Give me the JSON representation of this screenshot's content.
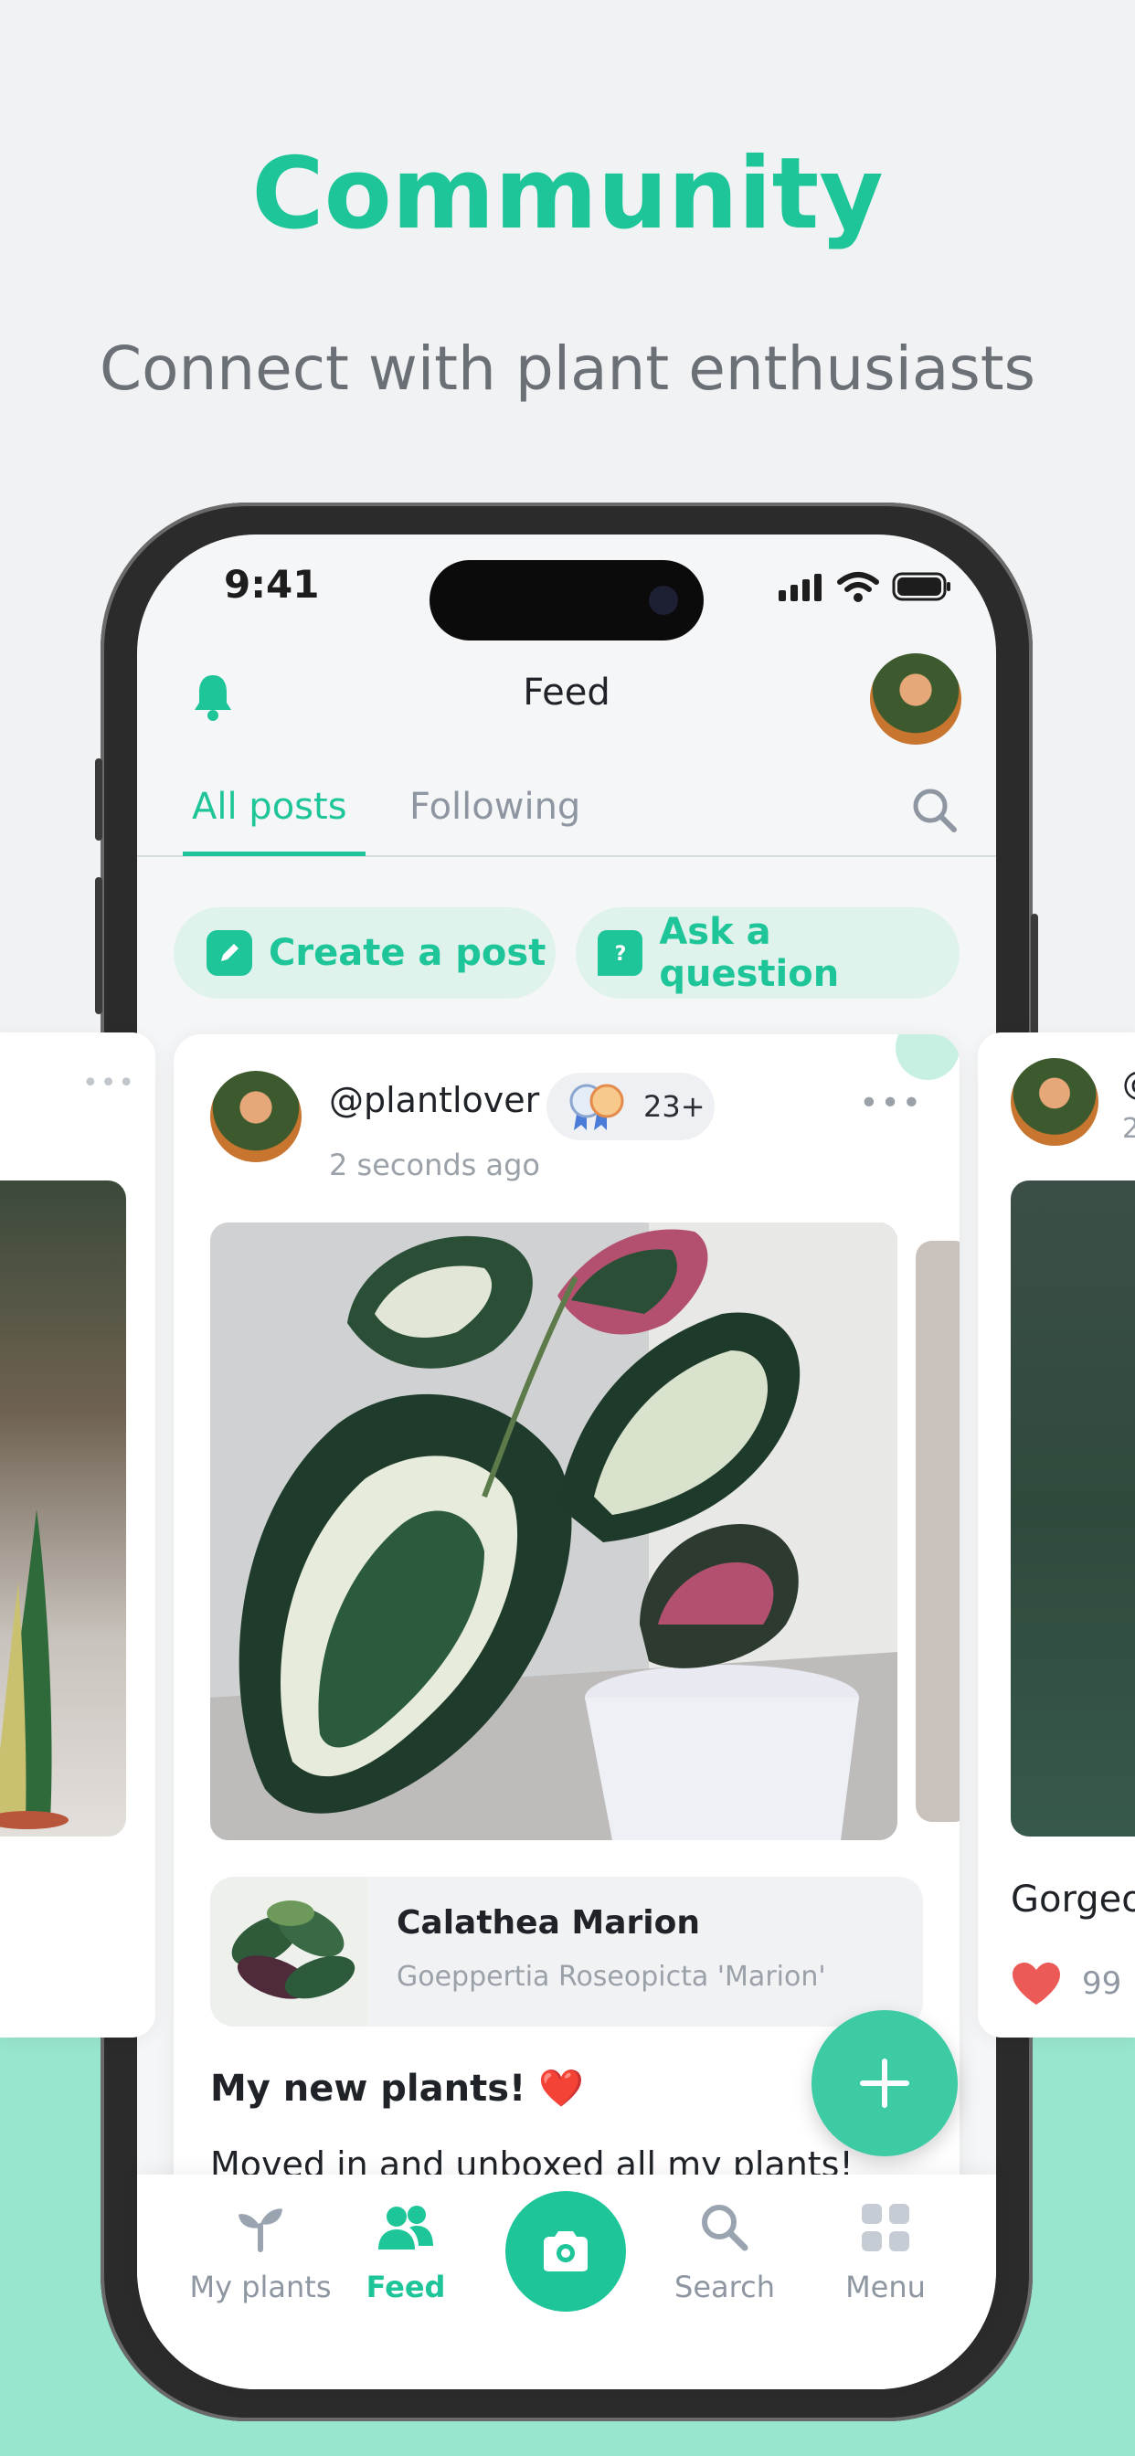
{
  "hero": {
    "title": "Community",
    "subtitle": "Connect with plant enthusiasts"
  },
  "status_bar": {
    "time": "9:41"
  },
  "header": {
    "title": "Feed",
    "bell_icon": "bell-icon",
    "avatar_icon": "profile-avatar"
  },
  "tabs": [
    {
      "label": "All posts",
      "active": true
    },
    {
      "label": "Following",
      "active": false
    }
  ],
  "actions": {
    "create_post": "Create a post",
    "ask_question": "Ask a question"
  },
  "post": {
    "username": "@plantlover",
    "badge_count": "23+",
    "time_ago": "2 seconds ago",
    "plant": {
      "name": "Calathea Marion",
      "scientific_name": "Goeppertia Roseopicta 'Marion'"
    },
    "title": "My new plants! ❤️",
    "body": "Moved in and unboxed all my plants!"
  },
  "right_card": {
    "caption_partial": "Gorgeo",
    "handle_partial": "@",
    "time_partial": "2",
    "likes": "99"
  },
  "nav": {
    "items": [
      {
        "label": "My plants",
        "icon": "sprout-icon",
        "active": false
      },
      {
        "label": "Feed",
        "icon": "people-icon",
        "active": true
      },
      {
        "label": "Search",
        "icon": "search-icon",
        "active": false
      },
      {
        "label": "Menu",
        "icon": "grid-icon",
        "active": false
      }
    ]
  },
  "colors": {
    "accent": "#1ec598",
    "accent_light": "#dff3ec",
    "bottom_band": "#98e6cf",
    "heart": "#ec5a58"
  }
}
